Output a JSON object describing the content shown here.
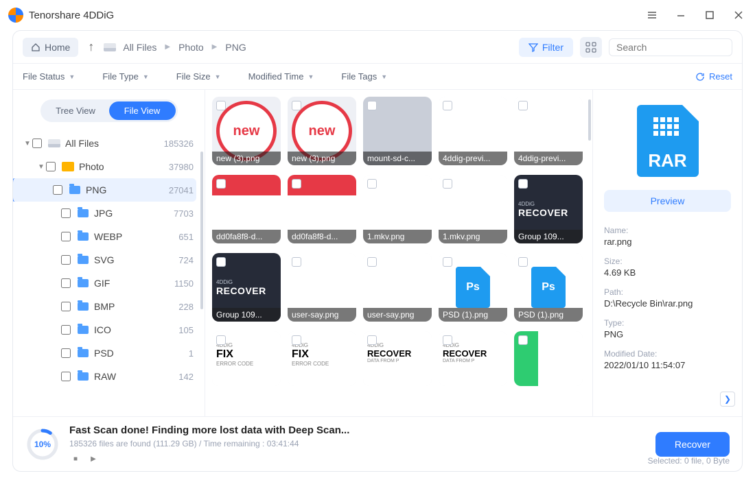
{
  "app": {
    "title": "Tenorshare 4DDiG"
  },
  "toolbar": {
    "home": "Home",
    "breadcrumb": [
      "All Files",
      "Photo",
      "PNG"
    ],
    "filter": "Filter",
    "search_placeholder": "Search"
  },
  "filters": {
    "items": [
      "File Status",
      "File Type",
      "File Size",
      "Modified Time",
      "File Tags"
    ],
    "reset": "Reset"
  },
  "view_switch": {
    "tree": "Tree View",
    "file": "File View"
  },
  "tree": {
    "root": {
      "label": "All Files",
      "count": "185326"
    },
    "photo": {
      "label": "Photo",
      "count": "37980"
    },
    "children": [
      {
        "label": "PNG",
        "count": "27041",
        "selected": true
      },
      {
        "label": "JPG",
        "count": "7703"
      },
      {
        "label": "WEBP",
        "count": "651"
      },
      {
        "label": "SVG",
        "count": "724"
      },
      {
        "label": "GIF",
        "count": "1150"
      },
      {
        "label": "BMP",
        "count": "228"
      },
      {
        "label": "ICO",
        "count": "105"
      },
      {
        "label": "PSD",
        "count": "1"
      },
      {
        "label": "RAW",
        "count": "142"
      }
    ]
  },
  "grid": {
    "row0": [
      "new (3).png",
      "new (3).png",
      "mount-sd-c...",
      "4ddig-previ...",
      "4ddig-previ..."
    ],
    "row1": [
      "dd0fa8f8-d...",
      "dd0fa8f8-d...",
      "1.mkv.png",
      "1.mkv.png",
      "Group 109..."
    ],
    "row2": [
      "Group 109...",
      "user-say.png",
      "user-say.png",
      "PSD (1).png",
      "PSD (1).png"
    ],
    "row3_labels": {
      "fix": "FIX",
      "recover": "RECOVER",
      "err": "ERROR CODE",
      "data": "DATA FROM P",
      "brand": "4DDiG"
    }
  },
  "preview": {
    "rar_label": "RAR",
    "button": "Preview",
    "name_k": "Name:",
    "name_v": "rar.png",
    "size_k": "Size:",
    "size_v": "4.69 KB",
    "path_k": "Path:",
    "path_v": "D:\\Recycle Bin\\rar.png",
    "type_k": "Type:",
    "type_v": "PNG",
    "mod_k": "Modified Date:",
    "mod_v": "2022/01/10 11:54:07"
  },
  "footer": {
    "pct": "10%",
    "title": "Fast Scan done! Finding more lost data with Deep Scan...",
    "sub": "185326 files are found (111.29 GB)  /  Time remaining : 03:41:44",
    "recover": "Recover",
    "selected": "Selected: 0 file, 0 Byte"
  }
}
